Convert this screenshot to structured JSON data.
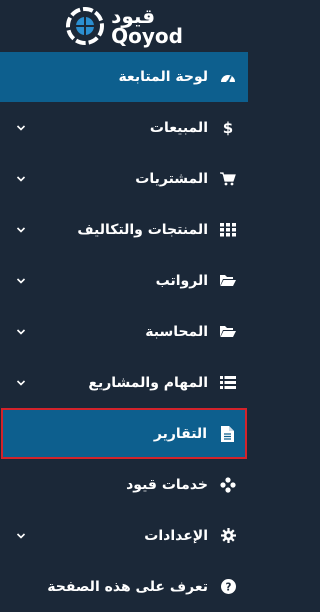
{
  "brand": {
    "name_ar": "قيود",
    "name_en": "Qoyod"
  },
  "menu": {
    "items": [
      {
        "label": "لوحة المتابعة",
        "icon": "dashboard-gauge-icon",
        "expandable": false,
        "state": "active"
      },
      {
        "label": "المبيعات",
        "icon": "dollar-icon",
        "expandable": true,
        "state": "normal"
      },
      {
        "label": "المشتريات",
        "icon": "shopping-cart-icon",
        "expandable": true,
        "state": "normal"
      },
      {
        "label": "المنتجات والتكاليف",
        "icon": "grid-icon",
        "expandable": true,
        "state": "normal"
      },
      {
        "label": "الرواتب",
        "icon": "folder-open-icon",
        "expandable": true,
        "state": "normal"
      },
      {
        "label": "المحاسبة",
        "icon": "folder-open-icon",
        "expandable": true,
        "state": "normal"
      },
      {
        "label": "المهام والمشاريع",
        "icon": "list-icon",
        "expandable": true,
        "state": "normal"
      },
      {
        "label": "التقارير",
        "icon": "file-text-icon",
        "expandable": false,
        "state": "selected"
      },
      {
        "label": "خدمات قيود",
        "icon": "services-cubes-icon",
        "expandable": false,
        "state": "normal"
      },
      {
        "label": "الإعدادات",
        "icon": "gear-icon",
        "expandable": true,
        "state": "normal"
      },
      {
        "label": "تعرف على هذه الصفحة",
        "icon": "question-circle-icon",
        "expandable": false,
        "state": "normal"
      }
    ]
  },
  "colors": {
    "background": "#1b2838",
    "active": "#0d5f8e",
    "highlight_border": "#d3232b"
  }
}
